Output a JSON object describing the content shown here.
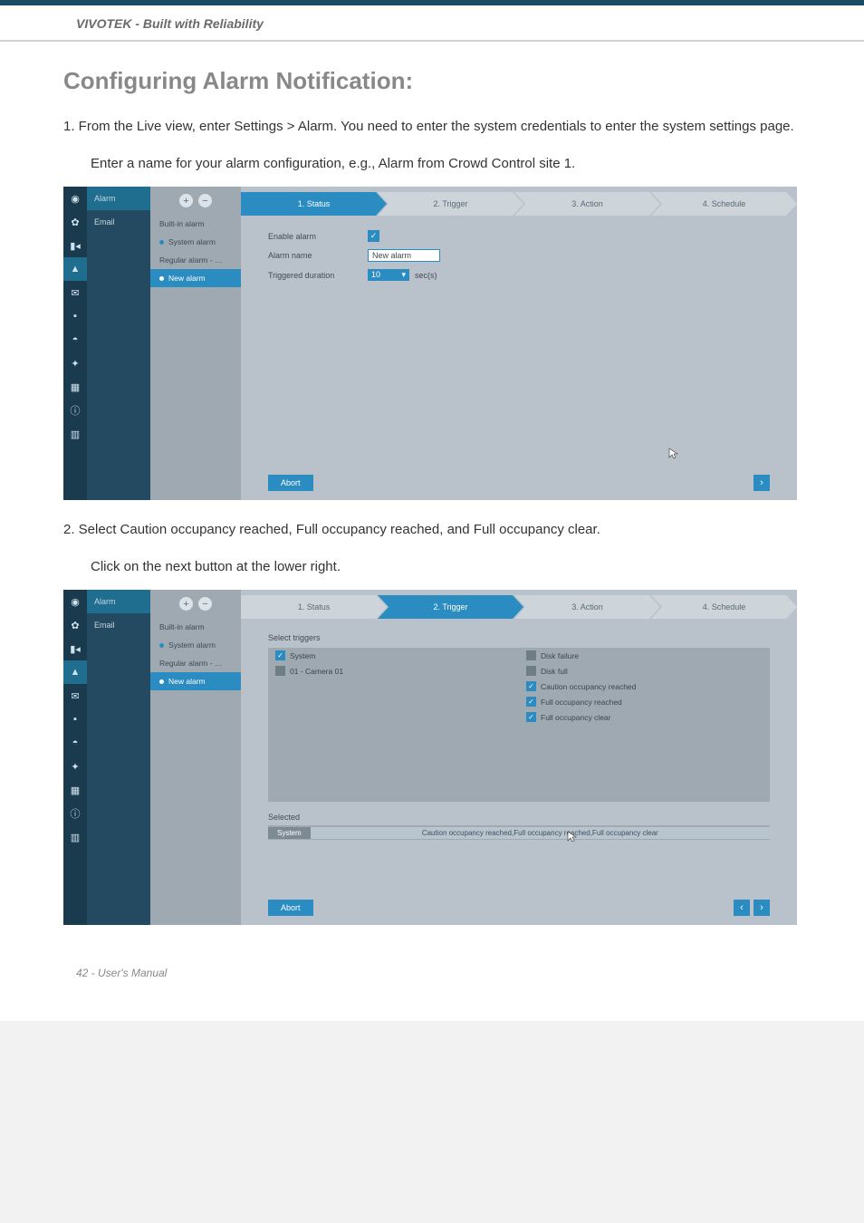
{
  "brand": "VIVOTEK - Built with Reliability",
  "title": "Configuring Alarm Notification:",
  "step1": "1. From the Live view, enter Settings > Alarm. You need to enter the system credentials to enter the system settings page.",
  "step1b": "Enter a name for your alarm configuration, e.g., Alarm from Crowd Control site 1.",
  "step2": "2. Select Caution occupancy reached, Full occupancy reached, and Full occupancy clear.",
  "step2b": "Click on the next button at the lower right.",
  "footer": "42 - User's Manual",
  "sub_nav": {
    "alarm": "Alarm",
    "email": "Email"
  },
  "alarm_list": {
    "builtin": "Built-in alarm",
    "system": "System alarm",
    "regular": "Regular alarm - …",
    "new_alarm": "New alarm"
  },
  "steps": {
    "s1": "1. Status",
    "s2": "2. Trigger",
    "s3": "3. Action",
    "s4": "4. Schedule"
  },
  "form": {
    "enable": "Enable alarm",
    "name_label": "Alarm name",
    "name_value": "New alarm",
    "dur_label": "Triggered duration",
    "dur_value": "10",
    "dur_unit": "sec(s)"
  },
  "abort": "Abort",
  "trigger": {
    "select_label": "Select triggers",
    "left_system": "System",
    "left_camera": "01 - Camera 01",
    "right": {
      "disk_failure": "Disk failure",
      "disk_full": "Disk full",
      "caution": "Caution occupancy reached",
      "full": "Full occupancy reached",
      "clear": "Full occupancy clear"
    },
    "selected_label": "Selected",
    "selected_system": "System",
    "selected_desc": "Caution occupancy reached,Full occupancy reached,Full occupancy clear"
  }
}
